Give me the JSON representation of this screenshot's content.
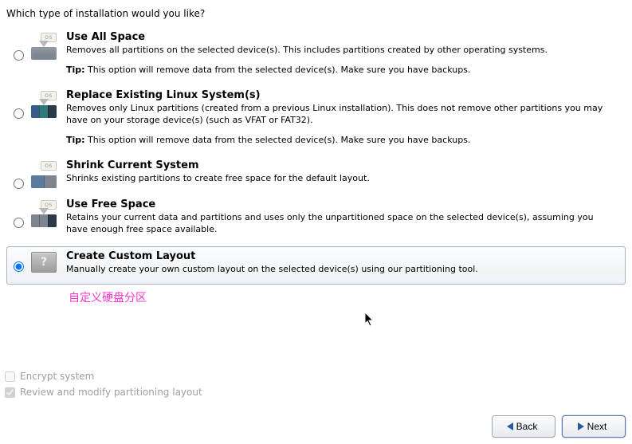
{
  "prompt": "Which type of installation would you like?",
  "options": [
    {
      "id": "use-all-space",
      "title": "Use All Space",
      "desc": "Removes all partitions on the selected device(s).  This includes partitions created by other operating systems.",
      "tip_label": "Tip:",
      "tip": " This option will remove data from the selected device(s).  Make sure you have backups.",
      "selected": false
    },
    {
      "id": "replace-existing-linux",
      "title": "Replace Existing Linux System(s)",
      "desc": "Removes only Linux partitions (created from a previous Linux installation).  This does not remove other partitions you may have on your storage device(s) (such as VFAT or FAT32).",
      "tip_label": "Tip:",
      "tip": " This option will remove data from the selected device(s).  Make sure you have backups.",
      "selected": false
    },
    {
      "id": "shrink-current-system",
      "title": "Shrink Current System",
      "desc": "Shrinks existing partitions to create free space for the default layout.",
      "tip_label": "",
      "tip": "",
      "selected": false
    },
    {
      "id": "use-free-space",
      "title": "Use Free Space",
      "desc": "Retains your current data and partitions and uses only the unpartitioned space on the selected device(s), assuming you have enough free space available.",
      "tip_label": "",
      "tip": "",
      "selected": false
    },
    {
      "id": "create-custom-layout",
      "title": "Create Custom Layout",
      "desc": "Manually create your own custom layout on the selected device(s) using our partitioning tool.",
      "tip_label": "",
      "tip": "",
      "selected": true
    }
  ],
  "annotation": "自定义硬盘分区",
  "checks": {
    "encrypt": {
      "label": "Encrypt system",
      "checked": false,
      "enabled": false
    },
    "review": {
      "label": "Review and modify partitioning layout",
      "checked": true,
      "enabled": false
    }
  },
  "footer": {
    "back": "Back",
    "next": "Next"
  },
  "icon_os_tag": "OS"
}
